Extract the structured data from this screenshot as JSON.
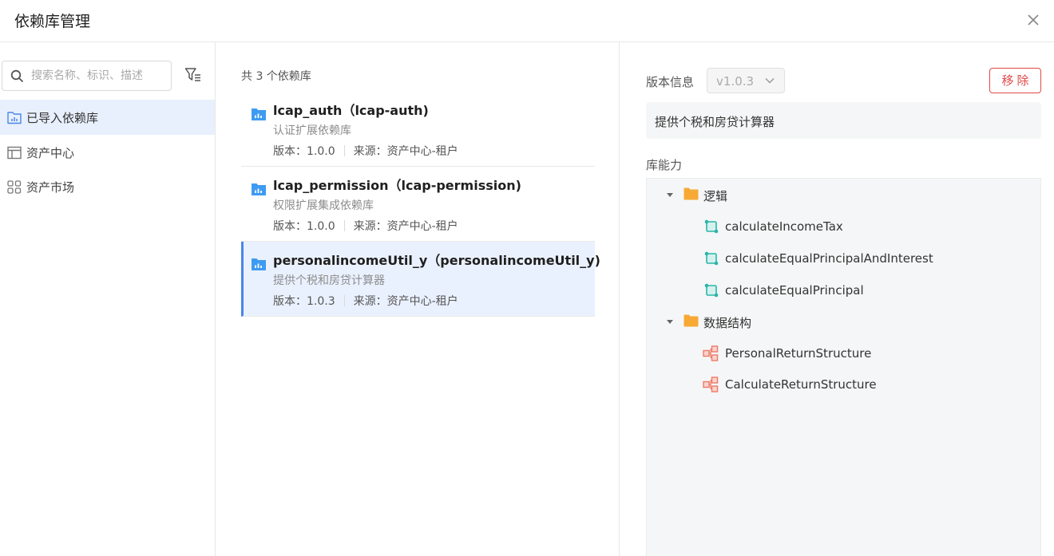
{
  "dialog": {
    "title": "依赖库管理"
  },
  "sidebar": {
    "search_placeholder": "搜索名称、标识、描述",
    "items": [
      {
        "label": "已导入依赖库",
        "active": true,
        "icon": "chart-folder-icon"
      },
      {
        "label": "资产中心",
        "active": false,
        "icon": "layout-icon"
      },
      {
        "label": "资产市场",
        "active": false,
        "icon": "grid-icon"
      }
    ]
  },
  "library_list": {
    "count_text": "共 3 个依赖库",
    "items": [
      {
        "name": "lcap_auth（lcap-auth)",
        "description": "认证扩展依赖库",
        "version": "版本：1.0.0",
        "source": "来源：资产中心-租户",
        "selected": false
      },
      {
        "name": "lcap_permission（lcap-permission)",
        "description": "权限扩展集成依赖库",
        "version": "版本：1.0.0",
        "source": "来源：资产中心-租户",
        "selected": false
      },
      {
        "name": "personalincomeUtil_y（personalincomeUtil_y)",
        "description": "提供个税和房贷计算器",
        "version": "版本：1.0.3",
        "source": "来源：资产中心-租户",
        "selected": true
      }
    ]
  },
  "detail": {
    "version_label": "版本信息",
    "version_value": "v1.0.3",
    "remove_label": "移除",
    "description": "提供个税和房贷计算器",
    "capability_label": "库能力",
    "tree": {
      "logic": {
        "label": "逻辑",
        "children": [
          "calculateIncomeTax",
          "calculateEqualPrincipalAndInterest",
          "calculateEqualPrincipal"
        ]
      },
      "structures": {
        "label": "数据结构",
        "children": [
          "PersonalReturnStructure",
          "CalculateReturnStructure"
        ]
      }
    }
  },
  "colors": {
    "accent": "#4a86e8",
    "danger": "#e04848",
    "folder": "#f7a934",
    "logic_icon": "#2bb5a9",
    "structure_icon": "#ec7b6a"
  }
}
